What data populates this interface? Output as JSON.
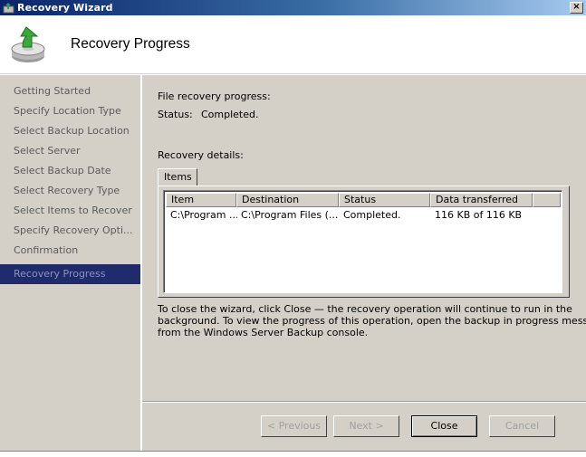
{
  "window": {
    "title": "Recovery Wizard",
    "close_glyph": "×"
  },
  "header": {
    "title": "Recovery Progress"
  },
  "sidebar": {
    "steps": [
      {
        "label": "Getting Started"
      },
      {
        "label": "Specify Location Type"
      },
      {
        "label": "Select Backup Location"
      },
      {
        "label": "Select Server"
      },
      {
        "label": "Select Backup Date"
      },
      {
        "label": "Select Recovery Type"
      },
      {
        "label": "Select Items to Recover"
      },
      {
        "label": "Specify Recovery Opti..."
      },
      {
        "label": "Confirmation"
      },
      {
        "label": "Recovery Progress"
      }
    ],
    "active_index": 9
  },
  "main": {
    "progress_label": "File recovery progress:",
    "status_label": "Status:",
    "status_value": "Completed.",
    "details_label": "Recovery details:",
    "tab_label": "Items",
    "table": {
      "columns": [
        "Item",
        "Destination",
        "Status",
        "Data transferred"
      ],
      "rows": [
        [
          "C:\\Program ...",
          "C:\\Program Files (...",
          "Completed.",
          "116 KB of 116 KB"
        ]
      ]
    },
    "info_lines": [
      "To close the wizard, click Close — the recovery operation will continue to run in the",
      "background. To view the progress of this operation, open the backup in progress message",
      "from the Windows Server Backup console."
    ]
  },
  "buttons": {
    "previous": "< Previous",
    "next": "Next >",
    "close": "Close",
    "cancel": "Cancel"
  },
  "colors": {
    "active_step_bg": "#1f2b6b",
    "dialog_bg": "#d4d0c8"
  }
}
